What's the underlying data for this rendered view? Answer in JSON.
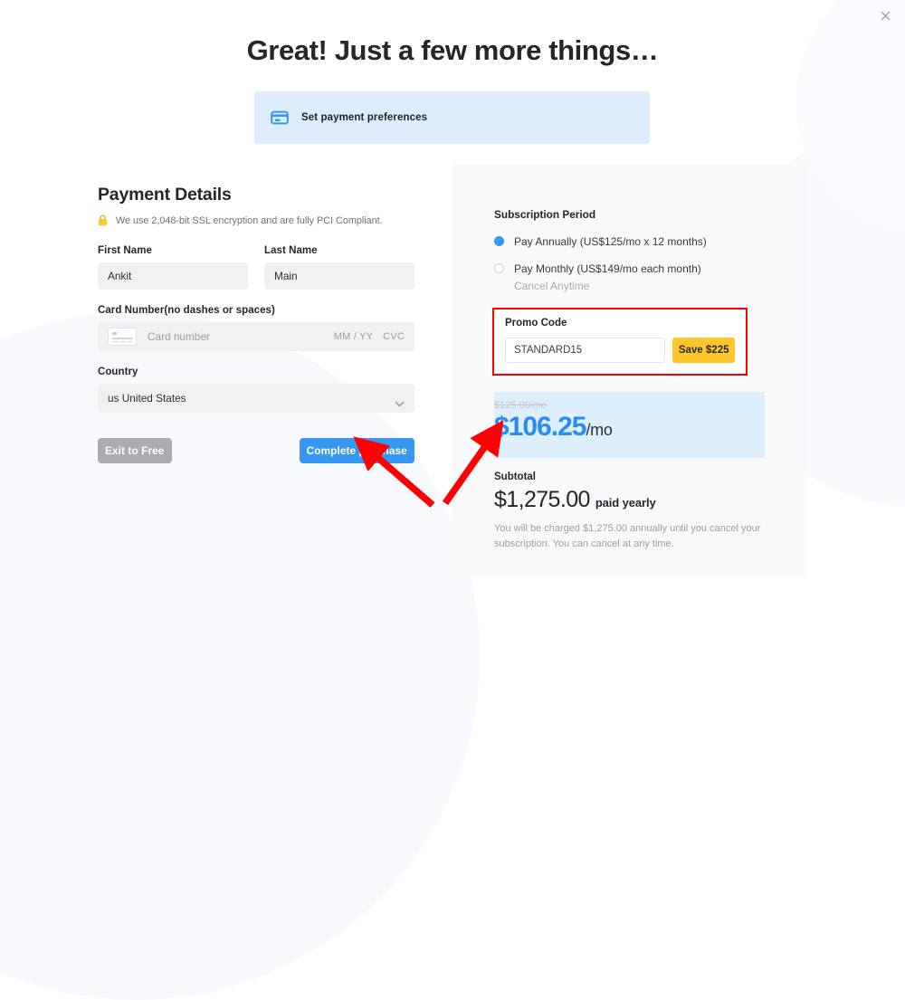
{
  "window": {
    "close_icon": "close-icon"
  },
  "header": {
    "title": "Great! Just a few more things…"
  },
  "banner": {
    "icon": "credit-card-icon",
    "label": "Set payment preferences",
    "background_color": "#ddedfd",
    "icon_color": "#3897f0"
  },
  "payment_details": {
    "section_title": "Payment Details",
    "lock_icon": "lock-icon",
    "ssl_notice": "We use 2,048-bit SSL encryption and are fully PCI Compliant.",
    "first_name": {
      "label": "First Name",
      "value": "Ankit",
      "placeholder": "First Name"
    },
    "last_name": {
      "label": "Last Name",
      "value": "Main",
      "placeholder": "Last Name"
    },
    "card_number": {
      "label": "Card Number(no dashes or spaces)",
      "value": "",
      "placeholder": "Card number",
      "expiry_placeholder": "MM / YY",
      "cvc_placeholder": "CVC",
      "icon": "credit-card-icon"
    },
    "country": {
      "label": "Country",
      "value": "us United States",
      "options": [
        "us United States"
      ],
      "chevron_icon": "chevron-down-icon"
    },
    "exit_button": "Exit to Free",
    "complete_button": "Complete purchase",
    "exit_button_color": "#a9adb2",
    "complete_button_color": "#3897f0"
  },
  "summary": {
    "subscription_period_label": "Subscription Period",
    "options": [
      {
        "label": "Pay Annually (US$125/mo x 12 months)",
        "selected": true,
        "sub": ""
      },
      {
        "label": "Pay Monthly (US$149/mo each month)",
        "selected": false,
        "sub": "Cancel Anytime"
      }
    ],
    "promo": {
      "label": "Promo Code",
      "value": "STANDARD15",
      "placeholder": "Promo Code",
      "button_label": "Save $225",
      "button_color": "#ffc62b",
      "highlight_border_color": "#ff0000"
    },
    "price": {
      "old": "$125.00/mo",
      "new": "$106.25",
      "period": "/mo",
      "accent_color": "#2c8bf2",
      "highlight_background": "#ddeefd"
    },
    "subtotal": {
      "label": "Subtotal",
      "amount": "$1,275.00",
      "cadence": "paid yearly",
      "note": "You will be charged $1,275.00 annually until you cancel your subscription. You can cancel at any time."
    }
  },
  "annotations": {
    "arrow_color": "#ff0000",
    "arrow_count": 2,
    "arrow_1_target": "complete-purchase-button",
    "arrow_2_target": "discounted-price"
  }
}
